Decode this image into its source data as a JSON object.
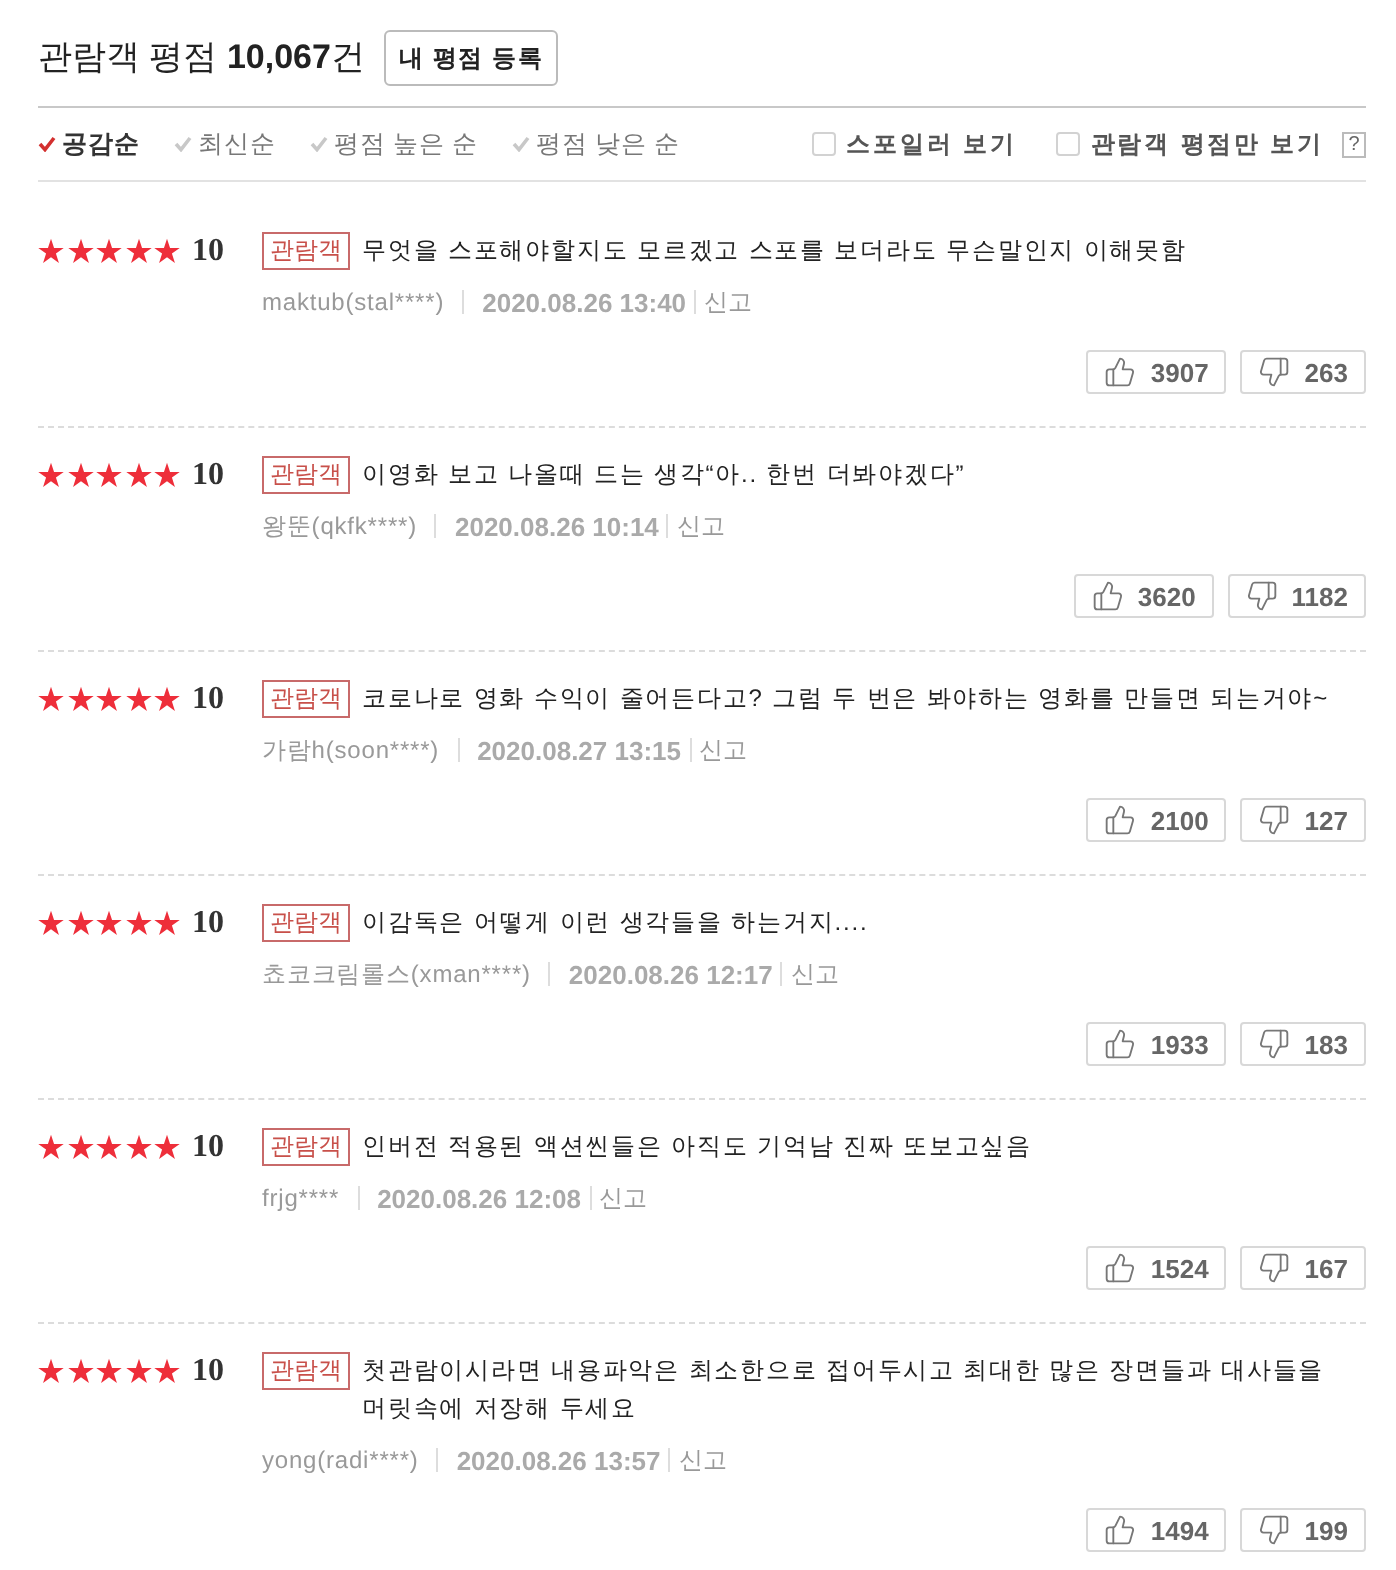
{
  "header": {
    "title": "관람객 평점 **10,067**건",
    "write_button": "내 평점 등록"
  },
  "sort_options": [
    {
      "label": "공감순",
      "selected": true
    },
    {
      "label": "최신순",
      "selected": false
    },
    {
      "label": "평점 높은 순",
      "selected": false
    },
    {
      "label": "평점 낮은 순",
      "selected": false
    }
  ],
  "filters": [
    {
      "label": "스포일러 보기",
      "checked": false
    },
    {
      "label": "관람객 평점만 보기",
      "checked": false
    }
  ],
  "help": "?",
  "reviews": [
    {
      "stars": 5,
      "score": "10",
      "badge": "관람객",
      "text": "무엇을 스포해야할지도 모르겠고 스포를 보더라도 무슨말인지 이해못함",
      "user": "maktub(stal****)",
      "date": "2020.08.26 13:40",
      "report": "신고",
      "likes": "3907",
      "dislikes": "263"
    },
    {
      "stars": 5,
      "score": "10",
      "badge": "관람객",
      "text": "이영화 보고 나올때 드는 생각“아.. 한번 더봐야겠다”",
      "user": "왕뚠(qkfk****)",
      "date": "2020.08.26 10:14",
      "report": "신고",
      "likes": "3620",
      "dislikes": "1182"
    },
    {
      "stars": 5,
      "score": "10",
      "badge": "관람객",
      "text": "코로나로 영화 수익이 줄어든다고? 그럼 두 번은 봐야하는 영화를 만들면 되는거야~",
      "user": "가람h(soon****)",
      "date": "2020.08.27 13:15",
      "report": "신고",
      "likes": "2100",
      "dislikes": "127"
    },
    {
      "stars": 5,
      "score": "10",
      "badge": "관람객",
      "text": "이감독은 어떻게 이런 생각들을 하는거지....",
      "user": "쵸코크림롤스(xman****)",
      "date": "2020.08.26 12:17",
      "report": "신고",
      "likes": "1933",
      "dislikes": "183"
    },
    {
      "stars": 5,
      "score": "10",
      "badge": "관람객",
      "text": "인버전 적용된 액션씬들은 아직도 기억남 진짜 또보고싶음",
      "user": "frjg****",
      "date": "2020.08.26 12:08",
      "report": "신고",
      "likes": "1524",
      "dislikes": "167"
    },
    {
      "stars": 5,
      "score": "10",
      "badge": "관람객",
      "text": "첫관람이시라면 내용파악은 최소한으로 접어두시고 최대한 많은 장면들과 대사들을 머릿속에 저장해 두세요",
      "user": "yong(radi****)",
      "date": "2020.08.26 13:57",
      "report": "신고",
      "likes": "1494",
      "dislikes": "199"
    }
  ]
}
